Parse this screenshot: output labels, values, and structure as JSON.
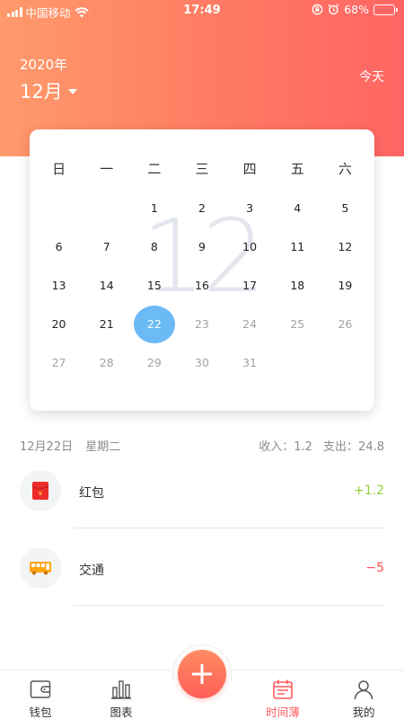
{
  "status_bar": {
    "carrier": "中国移动",
    "time": "17:49",
    "battery": "68%",
    "battery_level": 0.68
  },
  "header": {
    "year": "2020年",
    "month": "12月",
    "today_label": "今天"
  },
  "calendar": {
    "big_month": "12",
    "weekdays": [
      "日",
      "一",
      "二",
      "三",
      "四",
      "五",
      "六"
    ],
    "weeks": [
      [
        "",
        "",
        "1",
        "2",
        "3",
        "4",
        "5"
      ],
      [
        "6",
        "7",
        "8",
        "9",
        "10",
        "11",
        "12"
      ],
      [
        "13",
        "14",
        "15",
        "16",
        "17",
        "18",
        "19"
      ],
      [
        "20",
        "21",
        "22",
        "23",
        "24",
        "25",
        "26"
      ],
      [
        "27",
        "28",
        "29",
        "30",
        "31",
        "",
        ""
      ]
    ],
    "selected_day": "22",
    "future_from_day": 23
  },
  "summary": {
    "date": "12月22日",
    "weekday": "星期二",
    "income": "收入：1.2",
    "expense": "支出：24.8"
  },
  "records": [
    {
      "icon": "red-envelope-icon",
      "label": "红包",
      "amount": "+1.2",
      "color": "#8ed13a"
    },
    {
      "icon": "bus-icon",
      "label": "交通",
      "amount": "−5",
      "color": "#ff4a4a"
    }
  ],
  "tabbar": {
    "tabs": [
      {
        "label": "钱包",
        "icon": "wallet-icon"
      },
      {
        "label": "图表",
        "icon": "chart-icon"
      },
      {
        "label": "时间薄",
        "icon": "calendar-icon",
        "active": true
      },
      {
        "label": "我的",
        "icon": "user-icon"
      }
    ],
    "add_icon": "plus-icon"
  },
  "colors": {
    "accent": "#ff5a5a",
    "selected": "#6bbaf6",
    "income": "#8ed13a",
    "expense": "#ff4a4a"
  }
}
